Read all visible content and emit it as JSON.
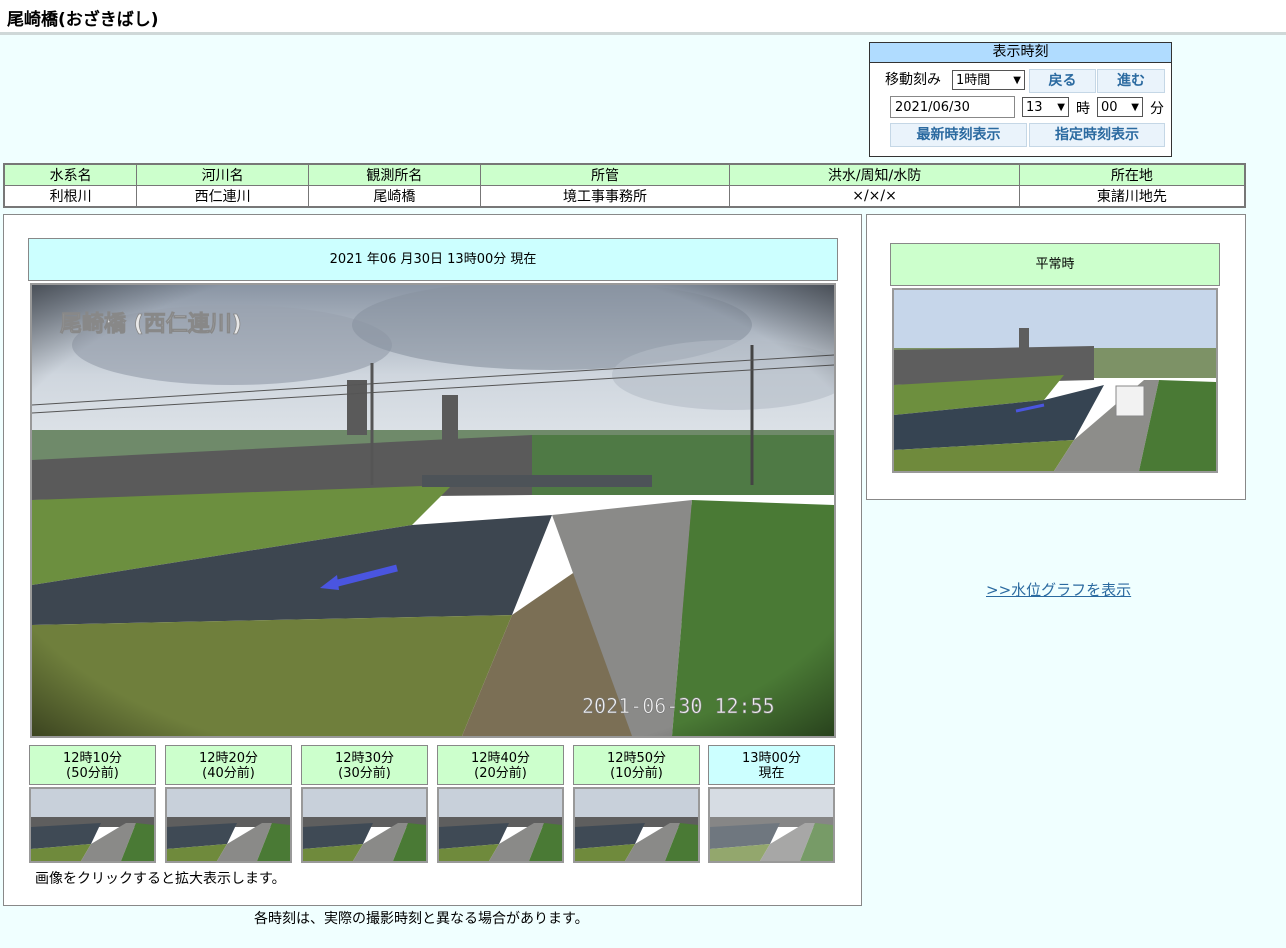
{
  "title": "尾崎橋(おざきばし)",
  "time_panel": {
    "header": "表示時刻",
    "step_label": "移動刻み",
    "step_value": "1時間",
    "back_label": "戻る",
    "forward_label": "進む",
    "date_value": "2021/06/30",
    "hour_value": "13",
    "hour_unit": "時",
    "minute_value": "00",
    "minute_unit": "分",
    "latest_label": "最新時刻表示",
    "specified_label": "指定時刻表示"
  },
  "info_table": {
    "headers": [
      "水系名",
      "河川名",
      "観測所名",
      "所管",
      "洪水/周知/水防",
      "所在地"
    ],
    "values": [
      "利根川",
      "西仁連川",
      "尾崎橋",
      "境工事事務所",
      "×/×/×",
      "東諸川地先"
    ]
  },
  "main": {
    "date_header": "2021 年06 月30日 13時00分 現在",
    "image_overlay_title": "尾崎橋 (西仁連川)",
    "image_timestamp": "2021-06-30  12:55",
    "click_note": "画像をクリックすると拡大表示します。"
  },
  "thumbnails": [
    {
      "time": "12時10分",
      "ago": "(50分前)"
    },
    {
      "time": "12時20分",
      "ago": "(40分前)"
    },
    {
      "time": "12時30分",
      "ago": "(30分前)"
    },
    {
      "time": "12時40分",
      "ago": "(20分前)"
    },
    {
      "time": "12時50分",
      "ago": "(10分前)"
    },
    {
      "time": "13時00分",
      "ago": "現在"
    }
  ],
  "reference": {
    "header": "平常時"
  },
  "graph_link": ">>水位グラフを表示",
  "footer_note": "各時刻は、実際の撮影時刻と異なる場合があります。",
  "colors": {
    "header_green": "#ccffcc",
    "header_cyan": "#ccffff",
    "panel_blue": "#b0dcff",
    "link": "#2b6aa0",
    "page_bg": "#f0ffff"
  }
}
